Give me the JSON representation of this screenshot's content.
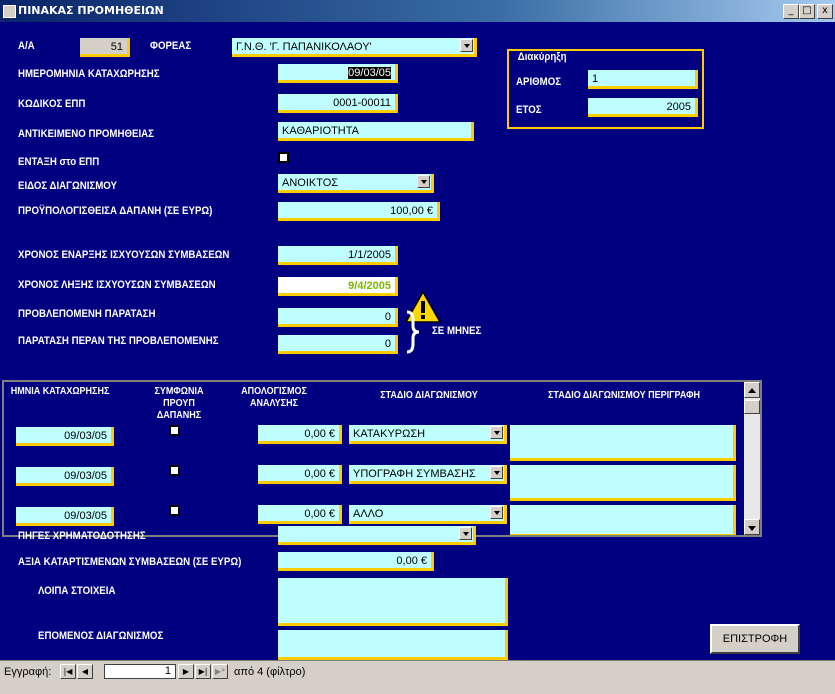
{
  "window": {
    "title": "ΠΙΝΑΚΑΣ ΠΡΟΜΗΘΕΙΩΝ",
    "min": "_",
    "max": "□",
    "close": "x"
  },
  "header": {
    "aa_label": "Α/Α",
    "aa_value": "51",
    "foreas_label": "ΦΟΡΕΑΣ",
    "foreas_value": "Γ.Ν.Θ. 'Γ. ΠΑΠΑΝΙΚΟΛΑΟΥ'"
  },
  "diakiriksi": {
    "title": "Διακύρηξη",
    "number_label": "ΑΡΙΘΜΟΣ",
    "number_value": "1",
    "year_label": "ΕΤΟΣ",
    "year_value": "2005"
  },
  "fields": {
    "date_label": "ΗΜΕΡΟΜΗΝΙΑ ΚΑΤΑΧΩΡΗΣΗΣ",
    "date_value": "09/03/05",
    "code_label": "ΚΩΔΙΚΟΣ ΕΠΠ",
    "code_value": "0001-00011",
    "subject_label": "ΑΝΤΙΚΕΙΜΕΝΟ ΠΡΟΜΗΘΕΙΑΣ",
    "subject_value": "ΚΑΘΑΡΙΟΤΗΤΑ",
    "entaxi_label": "ΕΝΤΑΞΗ στο ΕΠΠ",
    "type_label": "ΕΙΔΟΣ ΔΙΑΓΩΝΙΣΜΟΥ",
    "type_value": "ΑΝΟΙΚΤΟΣ",
    "budget_label": "ΠΡΟΫΠΟΛΟΓΙΣΘΕΙΣΑ ΔΑΠΑΝΗ (ΣΕ ΕΥΡΩ)",
    "budget_value": "100,00 €",
    "start_label": "ΧΡΟΝΟΣ ΕΝΑΡΞΗΣ ΙΣΧΥΟΥΣΩΝ ΣΥΜΒΑΣΕΩΝ",
    "start_value": "1/1/2005",
    "end_label": "ΧΡΟΝΟΣ ΛΗΞΗΣ ΙΣΧΥΟΥΣΩΝ ΣΥΜΒΑΣΕΩΝ",
    "end_value": "9/4/2005",
    "ext_label": "ΠΡΟΒΛΕΠΟΜΕΝΗ ΠΑΡΑΤΑΣΗ",
    "ext_value": "0",
    "ext2_label": "ΠΑΡΑΤΑΣΗ ΠΕΡΑΝ ΤΗΣ ΠΡΟΒΛΕΠΟΜΕΝΗΣ",
    "ext2_value": "0",
    "months_label": "ΣΕ ΜΗΝΕΣ"
  },
  "subform": {
    "headers": [
      "ΗΜΝΙΑ ΚΑΤΑΧΩΡΗΣΗΣ",
      "ΣΥΜΦΩΝΙΑ ΠΡΟΥΠ ΔΑΠΑΝΗΣ",
      "ΑΠΟΛΟΓΙΣΜΟΣ ΑΝΑΛΥΣΗΣ",
      "ΣΤΑΔΙΟ ΔΙΑΓΩΝΙΣΜΟΥ",
      "ΣΤΑΔΙΟ ΔΙΑΓΩΝΙΣΜΟΥ ΠΕΡΙΓΡΑΦΗ"
    ],
    "rows": [
      {
        "date": "09/03/05",
        "amount": "0,00 €",
        "stage": "ΚΑΤΑΚΥΡΩΣΗ",
        "desc": ""
      },
      {
        "date": "09/03/05",
        "amount": "0,00 €",
        "stage": "ΥΠΟΓΡΑΦΗ ΣΥΜΒΑΣΗΣ",
        "desc": ""
      },
      {
        "date": "09/03/05",
        "amount": "0,00 €",
        "stage": "ΑΛΛΟ",
        "desc": ""
      }
    ]
  },
  "bottom": {
    "sources_label": "ΠΗΓΕΣ ΧΡΗΜΑΤΟΔΟΤΗΣΗΣ",
    "sources_value": "",
    "value_label": "ΑΞΙΑ ΚΑΤΑΡΤΙΣΜΕΝΩΝ ΣΥΜΒΑΣΕΩΝ (ΣΕ ΕΥΡΩ)",
    "value_value": "0,00 €",
    "other_label": "ΛΟΙΠΑ ΣΤΟΙΧΕΙΑ",
    "next_label": "ΕΠΟΜΕΝΟΣ ΔΙΑΓΩΝΙΣΜΟΣ",
    "return_button": "ΕΠΙΣΤΡΟΦΗ"
  },
  "navigation": {
    "record_label": "Εγγραφή:",
    "current": "1",
    "of_text": "από 4 (φίλτρο)"
  },
  "colors": {
    "form_bg": "#000080",
    "field_bg": "#c0ffff",
    "accent": "#ffcc00",
    "warning": "#ffd700"
  }
}
